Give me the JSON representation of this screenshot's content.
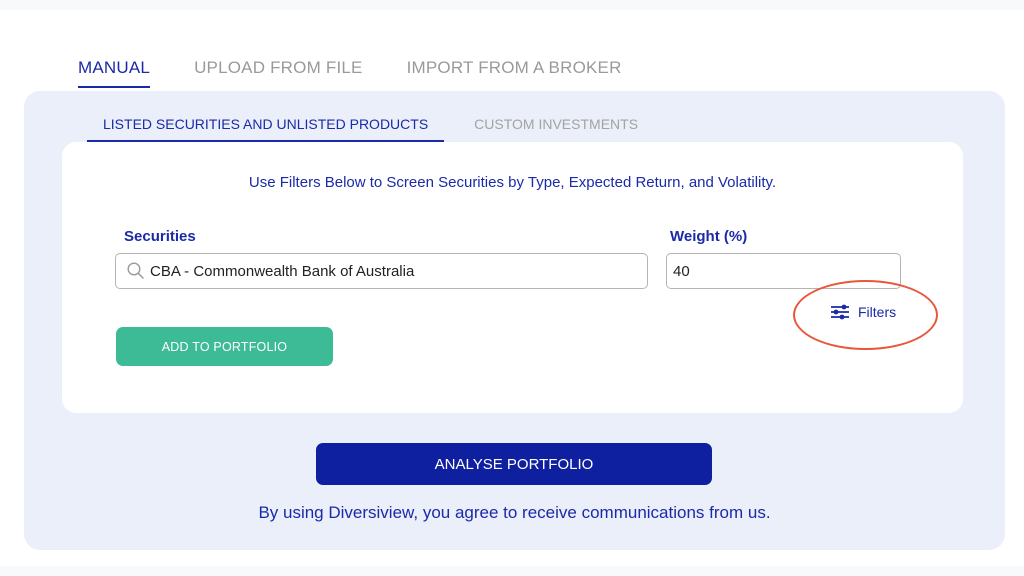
{
  "main_tabs": [
    {
      "label": "MANUAL",
      "active": true
    },
    {
      "label": "UPLOAD FROM FILE",
      "active": false
    },
    {
      "label": "IMPORT FROM A BROKER",
      "active": false
    }
  ],
  "sub_tabs": [
    {
      "label": "LISTED SECURITIES AND UNLISTED PRODUCTS",
      "active": true
    },
    {
      "label": "CUSTOM INVESTMENTS",
      "active": false
    }
  ],
  "form": {
    "instructions": "Use Filters Below to Screen Securities by Type, Expected Return, and Volatility.",
    "securities_label": "Securities",
    "securities_value": "CBA - Commonwealth Bank of Australia",
    "weight_label": "Weight (%)",
    "weight_value": "40",
    "filters_label": "Filters",
    "add_button_label": "ADD TO PORTFOLIO"
  },
  "actions": {
    "analyse_button_label": "ANALYSE PORTFOLIO",
    "consent_text": "By using Diversiview, you agree to receive communications from us."
  },
  "icons": {
    "search": "search-icon",
    "filters": "sliders-icon"
  },
  "colors": {
    "primary": "#1a2aa8",
    "analyse_button": "#0e1fa0",
    "add_button": "#3dba96",
    "panel_bg": "#ebeffa",
    "highlight": "#e8573a"
  }
}
